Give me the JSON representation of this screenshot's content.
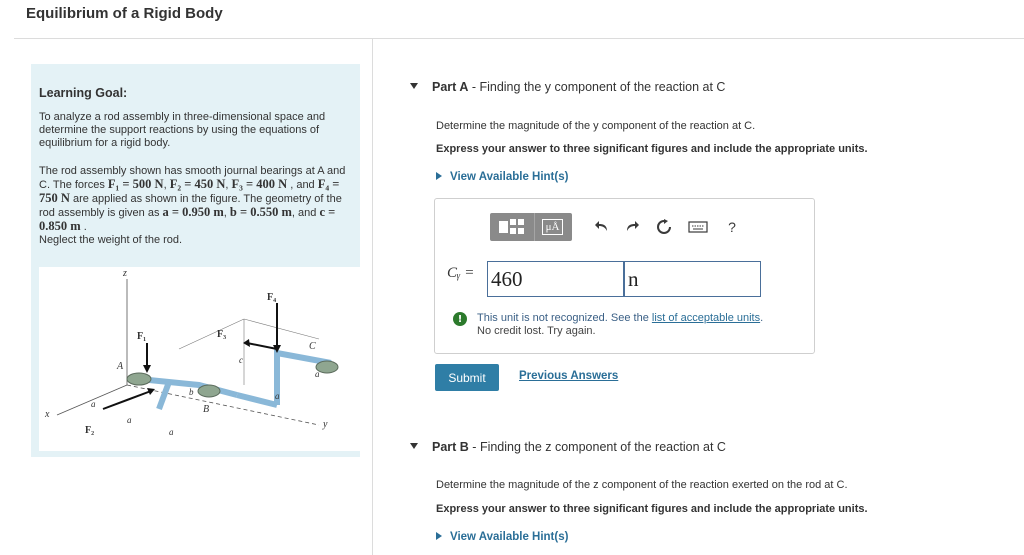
{
  "page": {
    "title": "Equilibrium of a Rigid Body"
  },
  "goal": {
    "title": "Learning Goal:",
    "text1": "To analyze a rod assembly in three-dimensional space and determine the support reactions by using the equations of equilibrium for a rigid body.",
    "text2_a": "The rod assembly shown has smooth journal bearings at A and C. The forces ",
    "f1": "F₁ = 500 N",
    "f2": "F₂ = 450 N",
    "f3": "F₃ = 400 N",
    "f4": "F₄ = 750 N",
    "text2_b": " are applied as shown in the figure. The geometry of the rod assembly is given as ",
    "a": "a = 0.950 m",
    "b": "b = 0.550 m",
    "c": "c = 0.850 m",
    "text2_c": "Neglect the weight of the rod."
  },
  "figure": {
    "labels": {
      "z": "z",
      "x": "x",
      "y": "y",
      "A": "A",
      "B": "B",
      "C": "C",
      "F1": "F₁",
      "F2": "F₂",
      "F3": "F₃",
      "F4": "F₄",
      "a": "a",
      "b": "b",
      "c": "c"
    }
  },
  "partA": {
    "label": "Part A",
    "title": "Finding the y component of the reaction at C",
    "instruction": "Determine the magnitude of the y component of the reaction at C.",
    "express": "Express your answer to three significant figures and include the appropriate units.",
    "hint": "View Available Hint(s)",
    "lhs": "Cᵧ =",
    "value": "460",
    "unit": "n",
    "toolbar_mu": "μÅ",
    "help": "?",
    "error": "This unit is not recognized. See the ",
    "error_link": "list of acceptable units",
    "error_end": ".",
    "error_sub": "No credit lost. Try again.",
    "submit": "Submit",
    "previous": "Previous Answers"
  },
  "partB": {
    "label": "Part B",
    "title": "Finding the z component of the reaction at C",
    "instruction": "Determine the magnitude of the z component of the reaction exerted on the rod at C.",
    "express": "Express your answer to three significant figures and include the appropriate units.",
    "hint": "View Available Hint(s)"
  },
  "colors": {
    "panel": "#e4f2f6",
    "accent": "#2a6e97",
    "submit": "#2f7ea6",
    "rod": "#a9cde6"
  }
}
